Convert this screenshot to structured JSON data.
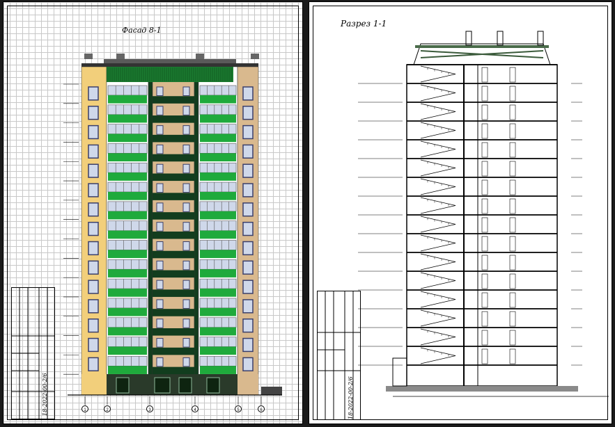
{
  "left_sheet": {
    "title": "Фасад 8-1",
    "floors": 16,
    "axis_marks": [
      "1",
      "2",
      "3",
      "4",
      "5",
      "6"
    ],
    "stamp_text": "18-2022-00-2/6"
  },
  "right_sheet": {
    "title": "Разрез 1-1",
    "floors": 16,
    "stamp_text": "18-2022-00-2/6"
  },
  "colors": {
    "background": "#1a1a1a",
    "sheet": "#ffffff",
    "grid": "#c8c8c8",
    "facade_yellow": "#f2cf7b",
    "facade_tan": "#d9b98e",
    "facade_green": "#1faa3c",
    "facade_dark_green": "#123d1e",
    "window_blue": "#cfd8ea",
    "window_frame": "#3a3f6b",
    "beige_frame": "#c9a67a"
  }
}
